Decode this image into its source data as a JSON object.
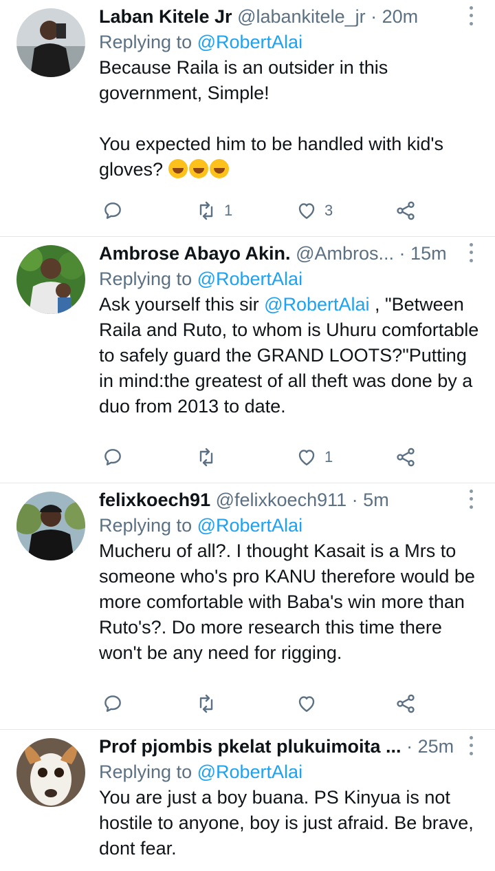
{
  "tweets": [
    {
      "name": "Laban Kitele Jr",
      "handle": "@labankitele_jr",
      "sep": "·",
      "time": "20m",
      "reply_prefix": "Replying to ",
      "reply_to": "@RobertAlai",
      "text_line1": "Because Raila is an outsider in this government, Simple!",
      "text_line2": "You expected him to be handled with kid's gloves?",
      "replies": "",
      "retweets": "1",
      "likes": "3"
    },
    {
      "name": "Ambrose Abayo Akin.",
      "handle": "@Ambros...",
      "sep": "·",
      "time": "15m",
      "reply_prefix": "Replying to ",
      "reply_to": "@RobertAlai",
      "text_before": "Ask yourself this sir ",
      "text_mention": "@RobertAlai",
      "text_after": " , \"Between Raila and Ruto, to whom is Uhuru comfortable to safely guard the GRAND LOOTS?\"Putting in mind:the greatest of all theft was done by a duo from 2013 to date.",
      "replies": "",
      "retweets": "",
      "likes": "1"
    },
    {
      "name": "felixkoech91",
      "handle": "@felixkoech911",
      "sep": "·",
      "time": "5m",
      "reply_prefix": "Replying to ",
      "reply_to": "@RobertAlai",
      "text": "Mucheru of all?. I thought Kasait is a Mrs to someone who's pro KANU therefore would be more comfortable with Baba's win more than Ruto's?. Do more research this time there won't be any need for rigging.",
      "replies": "",
      "retweets": "",
      "likes": ""
    },
    {
      "name": "Prof pjombis pkelat plukuimoita ...",
      "handle": "",
      "sep": "·",
      "time": "25m",
      "reply_prefix": "Replying to ",
      "reply_to": "@RobertAlai",
      "text": "You are just a boy buana. PS Kinyua is not hostile to anyone, boy is just afraid. Be brave, dont fear."
    }
  ],
  "icons": {
    "reply": "reply-icon",
    "retweet": "retweet-icon",
    "like": "heart-icon",
    "share": "share-icon",
    "more": "more-icon",
    "emoji": "rolling-laughing-emoji"
  },
  "colors": {
    "link": "#1da1f2",
    "secondary": "#5b7083",
    "divider": "#e1e8ed"
  }
}
